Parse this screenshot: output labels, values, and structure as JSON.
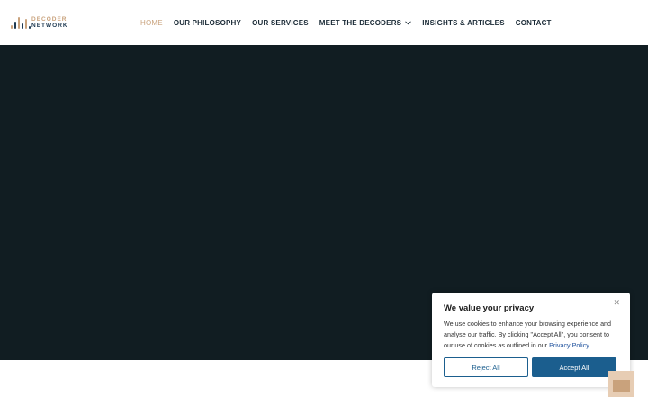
{
  "logo": {
    "line1": "DECODER",
    "line2": "NETWORK",
    "icon": "equalizer-bars-icon"
  },
  "nav": {
    "items": [
      {
        "label": "HOME",
        "active": true
      },
      {
        "label": "OUR PHILOSOPHY"
      },
      {
        "label": "OUR SERVICES"
      },
      {
        "label": "MEET THE DECODERS",
        "has_dropdown": true
      },
      {
        "label": "INSIGHTS & ARTICLES"
      },
      {
        "label": "CONTACT"
      }
    ]
  },
  "cookie_banner": {
    "title": "We value your privacy",
    "text": "We use cookies to enhance your browsing experience and analyse our traffic. By clicking \"Accept All\", you consent to our use of cookies as outlined in our ",
    "link": "Privacy Policy",
    "text_end": ".",
    "close_icon": "close-icon",
    "reject_label": "Reject All",
    "accept_label": "Accept All"
  },
  "colors": {
    "accent": "#c9a27c",
    "navy": "#1f3a52",
    "hero_bg": "#111d22",
    "button_blue": "#1b5e8e"
  },
  "back_to_top_icon": "back-to-top-icon"
}
